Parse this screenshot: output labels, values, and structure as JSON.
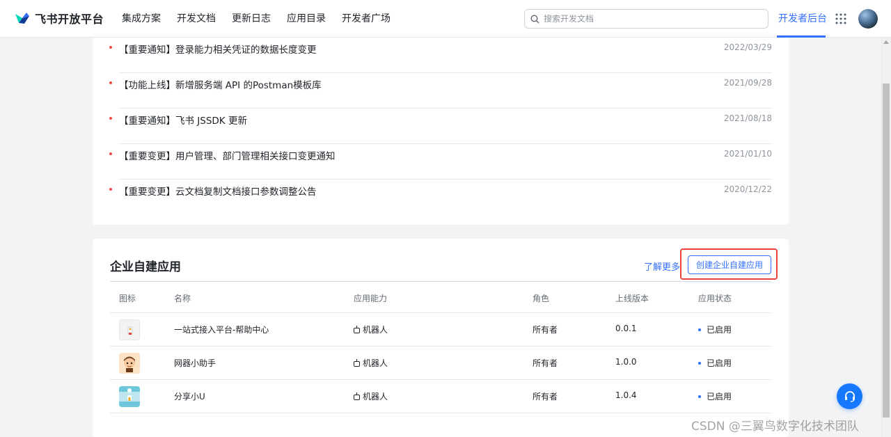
{
  "header": {
    "brand": "飞书开放平台",
    "nav": [
      "集成方案",
      "开发文档",
      "更新日志",
      "应用目录",
      "开发者广场"
    ],
    "search_placeholder": "搜索开发文档",
    "console_link": "开发者后台",
    "icons": {
      "search": "search-icon",
      "apps": "apps-grid-icon",
      "avatar": "user-avatar"
    },
    "accent_color": "#3370ff"
  },
  "notices": [
    {
      "title": "【重要通知】登录能力相关凭证的数据长度变更",
      "date": "2022/03/29"
    },
    {
      "title": "【功能上线】新增服务端 API 的Postman模板库",
      "date": "2021/09/28"
    },
    {
      "title": "【重要通知】飞书 JSSDK 更新",
      "date": "2021/08/18"
    },
    {
      "title": "【重要变更】用户管理、部门管理相关接口变更通知",
      "date": "2021/01/10"
    },
    {
      "title": "【重要变更】云文档复制文档接口参数调整公告",
      "date": "2020/12/22"
    }
  ],
  "apps_section": {
    "title": "企业自建应用",
    "learn_more": "了解更多",
    "create_button": "创建企业自建应用",
    "highlight_color": "#e8403a",
    "columns": [
      "图标",
      "名称",
      "应用能力",
      "角色",
      "上线版本",
      "应用状态"
    ],
    "rows": [
      {
        "name": "一站式接入平台-帮助中心",
        "capability": "机器人",
        "role": "所有者",
        "version": "0.0.1",
        "status": "已启用"
      },
      {
        "name": "网器小助手",
        "capability": "机器人",
        "role": "所有者",
        "version": "1.0.0",
        "status": "已启用"
      },
      {
        "name": "分享小U",
        "capability": "机器人",
        "role": "所有者",
        "version": "1.0.4",
        "status": "已启用"
      }
    ]
  },
  "watermark": "CSDN @三翼鸟数字化技术团队"
}
